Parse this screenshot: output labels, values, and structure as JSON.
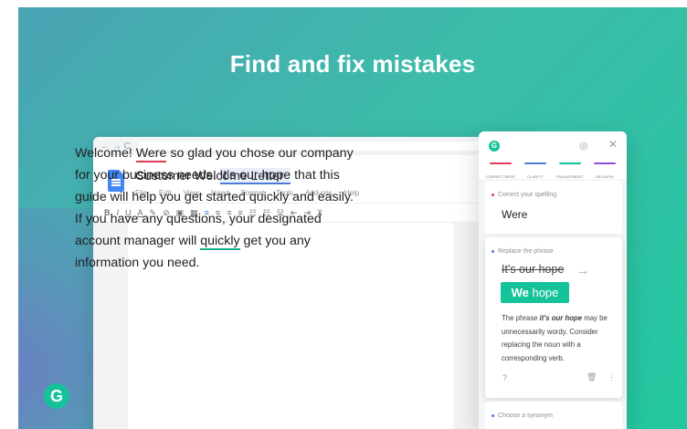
{
  "headline": "Find and fix mistakes",
  "browser": {
    "nav": "← → C"
  },
  "doc": {
    "title": "Customer Welcome Letter",
    "menus": [
      "File",
      "Edit",
      "View",
      "Insert",
      "Format",
      "Tools",
      "Add-ons",
      "Help"
    ],
    "toolbar": [
      "B",
      "I",
      "U",
      "A",
      "✎",
      "⊘",
      "▣",
      "▦",
      "≡",
      "≡",
      "≡",
      "≡",
      "☷",
      "☷",
      "☷",
      "⇤",
      "⇥",
      "Ⅹ"
    ],
    "toolbar_pen": "✎",
    "lines": [
      {
        "pre": "Welcome! ",
        "mark": "Were",
        "post": " so glad you chose our company"
      },
      {
        "pre": "for your business needs. ",
        "mark": "It's our hope",
        "post": " that this"
      },
      {
        "pre": "guide will help you get started quickly and easily.",
        "mark": "",
        "post": ""
      },
      {
        "pre": "If you have any questions, your designated",
        "mark": "",
        "post": ""
      },
      {
        "pre": "account manager will ",
        "mark": "quickly",
        "post": " get you any"
      },
      {
        "pre": "information you need.",
        "mark": "",
        "post": ""
      }
    ]
  },
  "panel": {
    "logo": "G",
    "goal_icon": "◎",
    "close_icon": "✕",
    "categories": [
      {
        "label": "CORRECTNESS",
        "color": "#e33b57"
      },
      {
        "label": "CLARITY",
        "color": "#4d7bd6"
      },
      {
        "label": "ENGAGEMENT",
        "color": "#15c39a"
      },
      {
        "label": "DELIVERY",
        "color": "#8a4fd6"
      }
    ],
    "card1": {
      "type": "Correct your spelling",
      "word": "Were"
    },
    "card2": {
      "type": "Replace the phrase",
      "old": "It's our hope",
      "arrow": "→",
      "suggest_bold": "We",
      "suggest_rest": " hope",
      "explain_a": "The phrase ",
      "explain_phrase": "it's our hope",
      "explain_b": " may be unnecessarily wordy. Consider replacing the noun with a corresponding verb.",
      "help": "?",
      "trash": "🗑",
      "more": "⋮"
    },
    "card3": {
      "type": "Choose a synonym"
    }
  },
  "corner_logo": "G"
}
